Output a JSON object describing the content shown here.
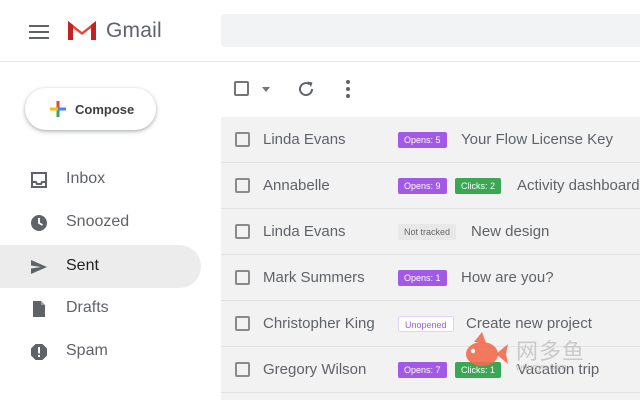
{
  "header": {
    "app_name": "Gmail",
    "brand_colors": {
      "red": "#EA4335",
      "logo_dark": "#C5221F"
    }
  },
  "sidebar": {
    "compose_label": "Compose",
    "items": [
      {
        "label": "Inbox",
        "icon": "inbox-icon",
        "active": false
      },
      {
        "label": "Snoozed",
        "icon": "clock-icon",
        "active": false
      },
      {
        "label": "Sent",
        "icon": "send-icon",
        "active": true
      },
      {
        "label": "Drafts",
        "icon": "draft-icon",
        "active": false
      },
      {
        "label": "Spam",
        "icon": "spam-icon",
        "active": false
      }
    ]
  },
  "toolbar": {
    "icons": [
      "checkbox",
      "caret-down-icon",
      "refresh-icon",
      "more-vert-icon"
    ]
  },
  "mails": [
    {
      "sender": "Linda Evans",
      "badges": [
        {
          "type": "opens",
          "label": "Opens: 5"
        }
      ],
      "subject": "Your Flow License Key"
    },
    {
      "sender": "Annabelle",
      "badges": [
        {
          "type": "opens",
          "label": "Opens: 9"
        },
        {
          "type": "clicks",
          "label": "Clicks: 2"
        }
      ],
      "subject": "Activity dashboard"
    },
    {
      "sender": "Linda Evans",
      "badges": [
        {
          "type": "nottracked",
          "label": "Not tracked"
        }
      ],
      "subject": "New design"
    },
    {
      "sender": "Mark Summers",
      "badges": [
        {
          "type": "opens",
          "label": "Opens: 1"
        }
      ],
      "subject": "How are you?"
    },
    {
      "sender": "Christopher King",
      "badges": [
        {
          "type": "unopened",
          "label": "Unopened"
        }
      ],
      "subject": "Create new project"
    },
    {
      "sender": "Gregory Wilson",
      "badges": [
        {
          "type": "opens",
          "label": "Opens: 7"
        },
        {
          "type": "clicks",
          "label": "Clicks: 1"
        }
      ],
      "subject": "Vacation trip"
    }
  ],
  "badge_colors": {
    "opens": "#A259E6",
    "clicks": "#3AA753"
  },
  "watermark": {
    "text": "网多鱼",
    "url": "wduoyu.com"
  }
}
